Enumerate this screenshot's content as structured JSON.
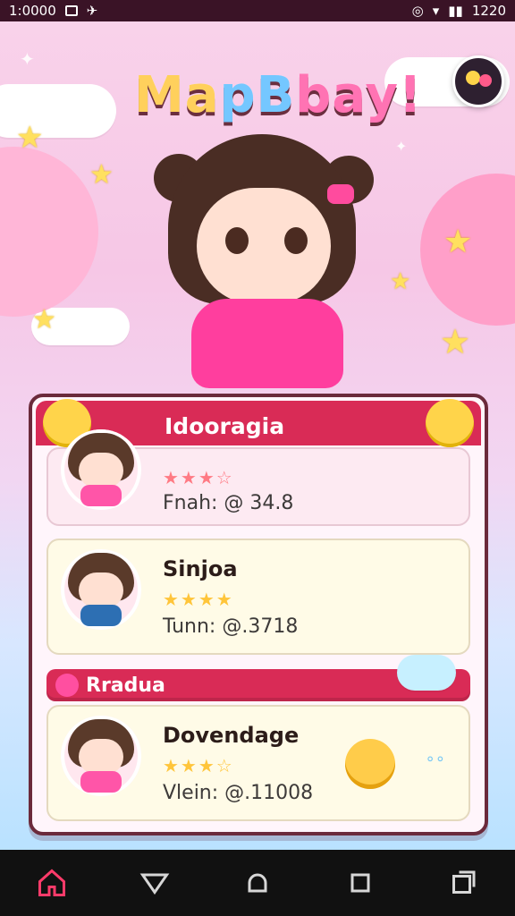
{
  "status_bar": {
    "left_text": "1:0000",
    "right_text": "1220"
  },
  "app": {
    "title_parts": [
      "Ma",
      "pB",
      "bay!"
    ],
    "profile_button_icon": "avatar-icon"
  },
  "card": {
    "header_title": "Idooragia",
    "items": [
      {
        "name": "",
        "stars_text": "★★★☆",
        "meta_text": "Fnah: @ 34.8"
      },
      {
        "name": "Sinjoa",
        "stars_text": "★★★★",
        "meta_text": "Tunn: @.3718"
      }
    ],
    "section_title": "Rradua",
    "section_items": [
      {
        "name": "Dovendage",
        "stars_text": "★★★☆",
        "meta_text": "Vlein: @.11008"
      }
    ]
  },
  "nav": {
    "home_icon": "home-icon",
    "send_icon": "send-icon",
    "circle_icon": "circle-icon",
    "square_icon": "square-icon",
    "window_icon": "window-icon"
  },
  "colors": {
    "accent": "#d92b56",
    "card_border": "#6b2a3b"
  }
}
